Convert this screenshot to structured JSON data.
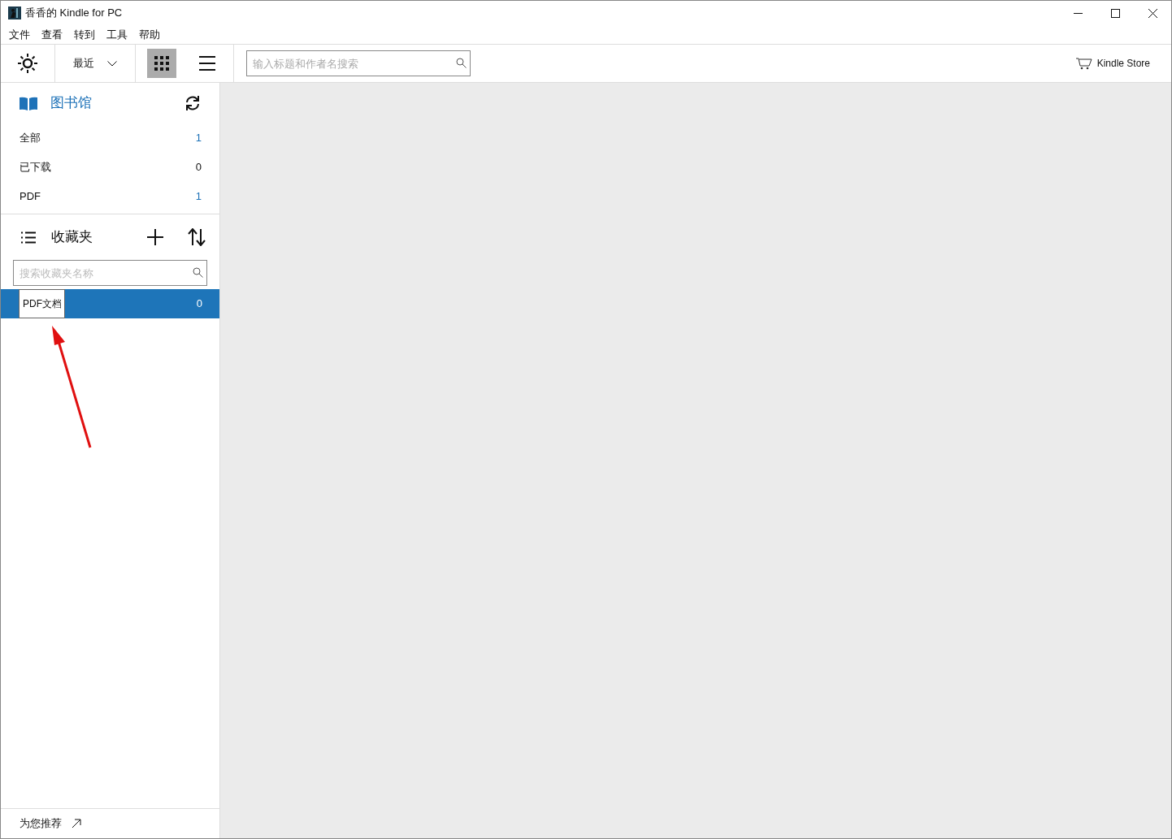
{
  "window": {
    "title": "香香的 Kindle for PC"
  },
  "menu": [
    "文件",
    "查看",
    "转到",
    "工具",
    "帮助"
  ],
  "toolbar": {
    "sort": "最近",
    "views": [
      {
        "kind": "grid",
        "selected": true
      },
      {
        "kind": "list",
        "selected": false
      }
    ],
    "search": {
      "placeholder": "输入标题和作者名搜索"
    },
    "store": "Kindle Store"
  },
  "library": {
    "title": "图书馆",
    "filters": [
      {
        "label": "全部",
        "count": "1",
        "highlighted": true
      },
      {
        "label": "已下载",
        "count": "0",
        "highlighted": false
      },
      {
        "label": "PDF",
        "count": "1",
        "highlighted": true
      }
    ]
  },
  "collections": {
    "title": "收藏夹",
    "search": {
      "placeholder": "搜索收藏夹名称"
    },
    "items": [
      {
        "name": "PDF文档",
        "count": "0",
        "selected": true,
        "editing": true
      }
    ]
  },
  "footer": {
    "link": "为您推荐"
  }
}
